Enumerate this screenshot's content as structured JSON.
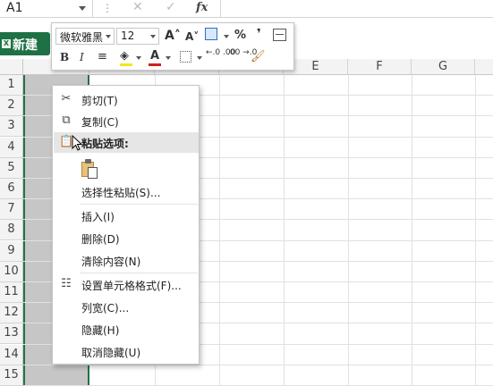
{
  "formula_bar": {
    "name_box": "A1",
    "dots": "⋮",
    "cancel_glyph": "✕",
    "confirm_glyph": "✓",
    "function_label": "fx"
  },
  "workbook_tab": {
    "icon_letter": "X",
    "label": "新建"
  },
  "grid": {
    "columns": [
      "E",
      "F",
      "G"
    ],
    "rows": [
      "1",
      "2",
      "3",
      "4",
      "5",
      "6",
      "7",
      "8",
      "9",
      "10",
      "11",
      "12",
      "13",
      "14",
      "15"
    ],
    "selection_color": "#217346",
    "selected_fill": "#c6c6c6"
  },
  "mini_toolbar": {
    "font_name": "微软雅黑",
    "font_size": "12",
    "grow_font": "A˄",
    "shrink_font": "A˅",
    "percent": "%",
    "comma": "❜",
    "bold": "B",
    "italic": "I",
    "align_center": "≡",
    "fill_color_glyph": "◈",
    "font_color_glyph": "A",
    "inc_decimal": "←.0 .00",
    "dec_decimal": ".00 →.0",
    "format_painter": "🖌",
    "icons": [
      "grow-font-icon",
      "shrink-font-icon",
      "number-format-icon",
      "percent-icon",
      "comma-style-icon",
      "merge-center-icon",
      "bold-icon",
      "italic-icon",
      "align-center-icon",
      "fill-color-icon",
      "font-color-icon",
      "borders-icon",
      "increase-decimal-icon",
      "decrease-decimal-icon",
      "format-painter-icon"
    ],
    "fill_color": "#f5e51f",
    "font_color": "#d11f1f"
  },
  "context_menu": {
    "cut": "剪切(T)",
    "copy": "复制(C)",
    "paste_options": "粘贴选项:",
    "paste_special": "选择性粘贴(S)...",
    "insert": "插入(I)",
    "delete": "删除(D)",
    "clear_contents": "清除内容(N)",
    "format_cells": "设置单元格格式(F)...",
    "column_width": "列宽(C)...",
    "hide": "隐藏(H)",
    "unhide": "取消隐藏(U)",
    "icons": [
      "scissors-icon",
      "copy-icon",
      "clipboard-icon",
      "format-cells-icon"
    ]
  }
}
